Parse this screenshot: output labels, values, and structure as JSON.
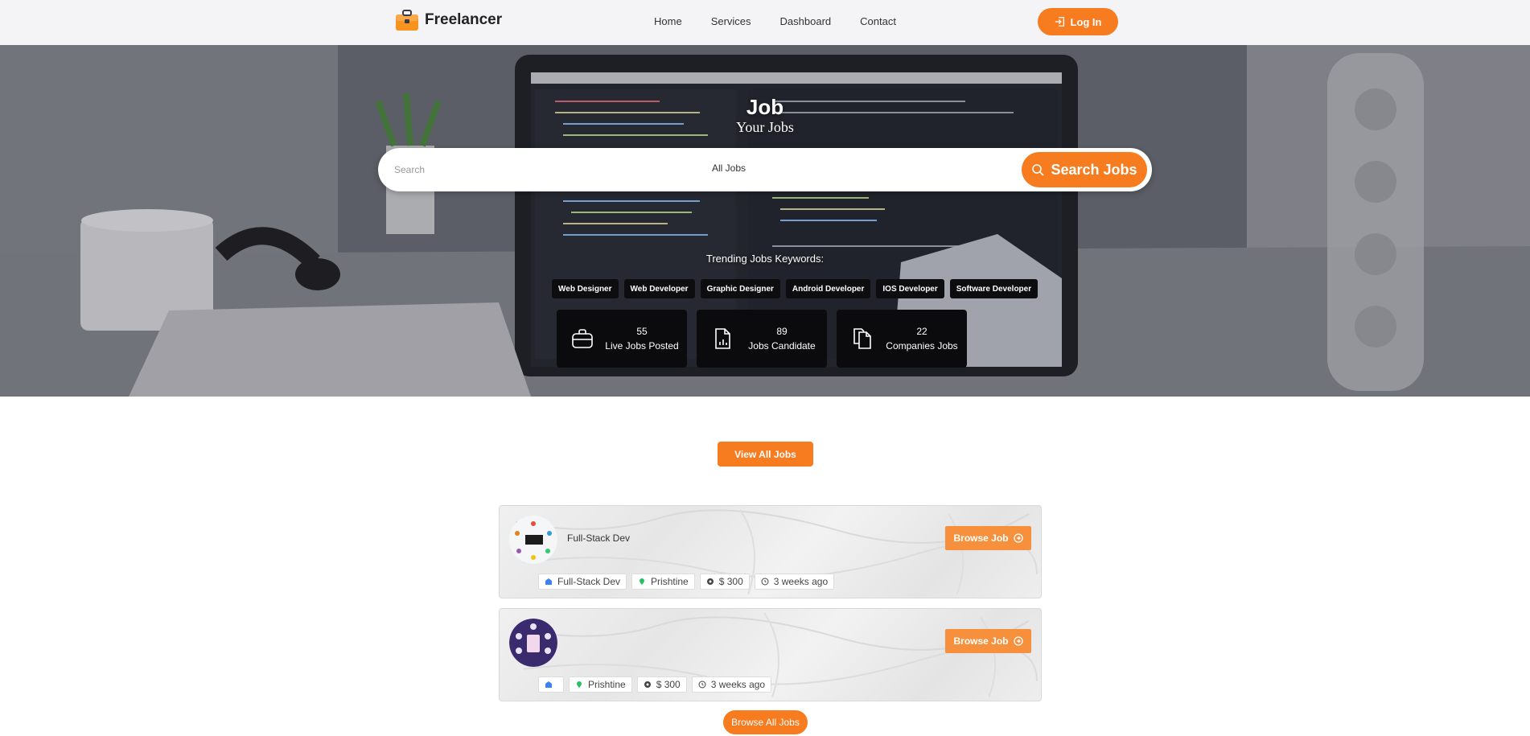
{
  "navbar": {
    "brand": "Freelancer",
    "brand_icon": "briefcase-icon",
    "links": [
      "Home",
      "Services",
      "Dashboard",
      "Contact"
    ],
    "login_label": "Log In",
    "login_icon": "login-icon"
  },
  "hero": {
    "title": "Job",
    "subtitle": "Your Jobs",
    "search": {
      "placeholder": "Search",
      "value": "",
      "category_selected": "All Jobs",
      "button_label": "Search Jobs"
    },
    "trending_label": "Trending Jobs Keywords:",
    "tags": [
      "Web Designer",
      "Web Developer",
      "Graphic Designer",
      "Android Developer",
      "IOS Developer",
      "Software Developer"
    ],
    "stats": [
      {
        "number": "55",
        "label": "Live Jobs Posted",
        "icon": "briefcase-icon"
      },
      {
        "number": "89",
        "label": "Jobs Candidate",
        "icon": "document-chart-icon"
      },
      {
        "number": "22",
        "label": "Companies Jobs",
        "icon": "copy-documents-icon"
      }
    ]
  },
  "view_all_label": "View All Jobs",
  "jobs": [
    {
      "title": "Full-Stack Dev",
      "category": "Full-Stack Dev",
      "location": "Prishtine",
      "salary": "$ 300",
      "posted": "3 weeks ago",
      "browse_label": "Browse Job"
    },
    {
      "title": "",
      "category": "",
      "location": "Prishtine",
      "salary": "$ 300",
      "posted": "3 weeks ago",
      "browse_label": "Browse Job"
    }
  ],
  "browse_all_label": "Browse All Jobs",
  "colors": {
    "accent": "#f77b1f",
    "accent_light": "#f7903d",
    "dark_card": "#0b0b0d",
    "nav_bg": "#f4f4f6"
  }
}
